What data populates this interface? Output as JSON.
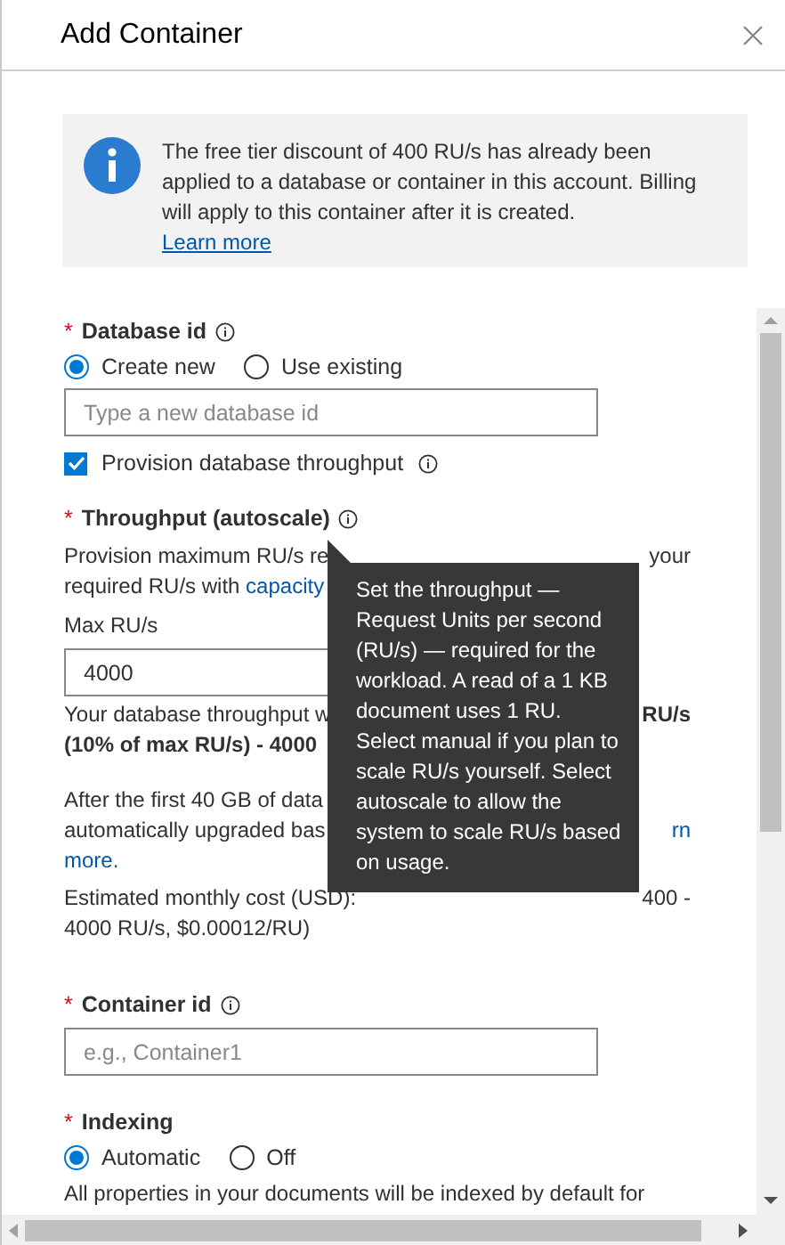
{
  "title": "Add Container",
  "notice": {
    "text": "The free tier discount of 400 RU/s has already been applied to a database or container in this account. Billing will apply to this container after it is created.",
    "link": "Learn more"
  },
  "database_id": {
    "label": "Database id",
    "required_mark": "*",
    "options": [
      {
        "label": "Create new",
        "selected": true
      },
      {
        "label": "Use existing",
        "selected": false
      }
    ],
    "placeholder": "Type a new database id",
    "provision": {
      "label": "Provision database throughput",
      "checked": true
    }
  },
  "throughput": {
    "label": "Throughput (autoscale)",
    "required_mark": "*",
    "description": [
      {
        "left": [
          {
            "kind": "plain",
            "text": "Provision maximum RU/s re"
          }
        ],
        "right": [
          {
            "kind": "plain",
            "text": "your"
          }
        ]
      },
      {
        "left": [
          {
            "kind": "plain",
            "text": "required RU/s with "
          },
          {
            "kind": "link",
            "text": "capacity"
          }
        ]
      }
    ],
    "max_label": "Max RU/s",
    "max_value": "4000",
    "usage_note": [
      {
        "left": [
          {
            "kind": "plain",
            "text": "Your database throughput w"
          }
        ],
        "right": [
          {
            "kind": "bold",
            "text": "RU/s"
          }
        ]
      },
      {
        "left": [
          {
            "kind": "bold",
            "text": "(10% of max RU/s) - 4000"
          }
        ]
      }
    ],
    "storage_note": [
      {
        "left": [
          {
            "kind": "plain",
            "text": "After the first 40 GB of data"
          }
        ]
      },
      {
        "left": [
          {
            "kind": "plain",
            "text": "automatically upgraded bas"
          }
        ],
        "right": [
          {
            "kind": "link",
            "text": "rn"
          }
        ]
      },
      {
        "left": [
          {
            "kind": "link",
            "text": "more."
          }
        ]
      }
    ],
    "cost_note": [
      {
        "left": [
          {
            "kind": "plain",
            "text": "Estimated monthly cost (USD):"
          }
        ],
        "right": [
          {
            "kind": "plain",
            "text": "400 -"
          }
        ]
      },
      {
        "left": [
          {
            "kind": "plain",
            "text": "4000 RU/s, $0.00012/RU)"
          }
        ]
      }
    ],
    "tooltip": "Set the throughput — Request Units per second (RU/s) — required for the workload. A read of a 1 KB document uses 1 RU. Select manual if you plan to scale RU/s yourself. Select autoscale to allow the system to scale RU/s based on usage."
  },
  "container_id": {
    "label": "Container id",
    "required_mark": "*",
    "placeholder": "e.g., Container1"
  },
  "indexing": {
    "label": "Indexing",
    "required_mark": "*",
    "options": [
      {
        "label": "Automatic",
        "selected": true
      },
      {
        "label": "Off",
        "selected": false
      }
    ],
    "note": "All properties in your documents will be indexed by default for"
  }
}
